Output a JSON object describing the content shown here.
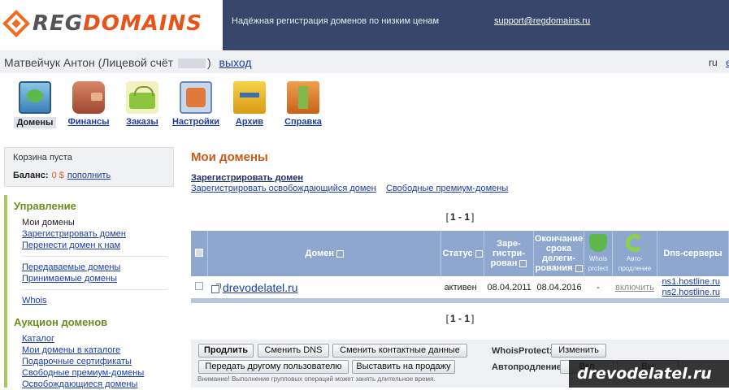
{
  "header": {
    "logo_reg": "REG",
    "logo_domains": "DOMAINS",
    "tagline": "Надёжная регистрация доменов по низким ценам",
    "support_email": "support@regdomains.ru"
  },
  "user": {
    "name_prefix": "Матвейчук Антон (Лицевой счёт",
    "name_suffix": ")",
    "logout": "выход",
    "lang_ru": "ru",
    "lang_en": "e"
  },
  "nav": {
    "items": [
      {
        "label": "Домены",
        "icon": "monitor-globe-icon"
      },
      {
        "label": "Финансы",
        "icon": "wallet-icon"
      },
      {
        "label": "Заказы",
        "icon": "basket-icon"
      },
      {
        "label": "Настройки",
        "icon": "settings-map-icon"
      },
      {
        "label": "Архив",
        "icon": "archive-folder-icon"
      },
      {
        "label": "Справка",
        "icon": "help-book-icon"
      }
    ]
  },
  "cart": {
    "empty": "Корзина пуста",
    "balance_label": "Баланс:",
    "balance_value": "0 $",
    "topup": "пополнить"
  },
  "sidebar": {
    "manage_title": "Управление",
    "manage_items": [
      "Мои домены",
      "Зарегистрировать домен",
      "Перенести домен к нам"
    ],
    "transfer_items": [
      "Передаваемые домены",
      "Принимаемые домены"
    ],
    "whois": "Whois",
    "auction_title": "Аукцион доменов",
    "auction_items": [
      "Каталог",
      "Мои домены в каталоге",
      "Подарочные сертификаты",
      "Свободные премиум-домены",
      "Освобождающиеся домены"
    ]
  },
  "main": {
    "title": "Мои домены",
    "register_link": "Зарегистрировать домен",
    "register_free_link": "Зарегистрировать освобождающийся домен",
    "premium_link": "Свободные премиум-домены",
    "pager": "1 - 1"
  },
  "table": {
    "headers": {
      "domain": "Домен",
      "status": "Статус",
      "registered": "Заре-гистри-рован",
      "expires": "Окончание срока делеги-рования",
      "whois": "Whois protect",
      "autorenew": "Авто-продление",
      "dns": "Dns-серверы"
    },
    "rows": [
      {
        "domain": "drevodelatel.ru",
        "status": "активен",
        "registered": "08.04.2011",
        "expires": "08.04.2016",
        "whois": "-",
        "autorenew": "включить",
        "dns1": "ns1.hostline.ru",
        "dns2": "ns2.hostline.ru"
      }
    ]
  },
  "actions": {
    "renew": "Продлить",
    "change_dns": "Сменить DNS",
    "change_contacts": "Сменить контактные данные",
    "transfer_user": "Передать другому пользователю",
    "sell": "Выставить на продажу",
    "whois_label": "WhoisProtect:",
    "whois_change": "Изменить",
    "autorenew_label": "Автопродление:",
    "autorenew_on": "Вкл",
    "autorenew_off": "Вы",
    "warning": "Внимание! Выполнение групповых операций может занять длительное время."
  },
  "watermark": "drevodelatel.ru",
  "colors": {
    "brand_orange": "#e8531a",
    "header_navy": "#37476b",
    "table_header": "#8ea7cf",
    "sidebar_accent": "#a9c95c"
  }
}
